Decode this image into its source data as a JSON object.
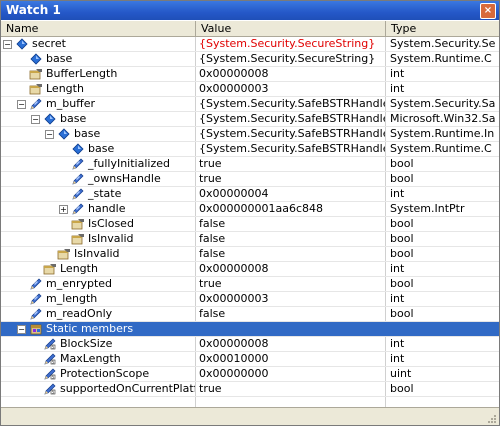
{
  "window": {
    "title": "Watch 1",
    "close_glyph": "×"
  },
  "columns": {
    "name": "Name",
    "value": "Value",
    "type": "Type"
  },
  "rows": [
    {
      "name": "secret",
      "value": "{System.Security.SecureString}",
      "type": "System.Security.Se",
      "indent": 0,
      "expander": "−",
      "icon": "field-icon",
      "value_red": true
    },
    {
      "name": "base",
      "value": "{System.Security.SecureString}",
      "type": "System.Runtime.C",
      "indent": 1,
      "expander": "",
      "icon": "field-icon",
      "value_red": false
    },
    {
      "name": "BufferLength",
      "value": "0x00000008",
      "type": "int",
      "indent": 1,
      "expander": "",
      "icon": "property-icon",
      "value_red": false
    },
    {
      "name": "Length",
      "value": "0x00000003",
      "type": "int",
      "indent": 1,
      "expander": "",
      "icon": "property-icon",
      "value_red": false
    },
    {
      "name": "m_buffer",
      "value": "{System.Security.SafeBSTRHandle}",
      "type": "System.Security.Sa",
      "indent": 1,
      "expander": "−",
      "icon": "pencil-icon",
      "value_red": false
    },
    {
      "name": "base",
      "value": "{System.Security.SafeBSTRHandle}",
      "type": "Microsoft.Win32.Sa",
      "indent": 2,
      "expander": "−",
      "icon": "field-icon",
      "value_red": false
    },
    {
      "name": "base",
      "value": "{System.Security.SafeBSTRHandle}",
      "type": "System.Runtime.In",
      "indent": 3,
      "expander": "−",
      "icon": "field-icon",
      "value_red": false
    },
    {
      "name": "base",
      "value": "{System.Security.SafeBSTRHandle}",
      "type": "System.Runtime.C",
      "indent": 4,
      "expander": "",
      "icon": "field-icon",
      "value_red": false
    },
    {
      "name": "_fullyInitialized",
      "value": "true",
      "type": "bool",
      "indent": 4,
      "expander": "",
      "icon": "pencil-icon",
      "value_red": false
    },
    {
      "name": "_ownsHandle",
      "value": "true",
      "type": "bool",
      "indent": 4,
      "expander": "",
      "icon": "pencil-icon",
      "value_red": false
    },
    {
      "name": "_state",
      "value": "0x00000004",
      "type": "int",
      "indent": 4,
      "expander": "",
      "icon": "pencil-icon",
      "value_red": false
    },
    {
      "name": "handle",
      "value": "0x000000001aa6c848",
      "type": "System.IntPtr",
      "indent": 4,
      "expander": "+",
      "icon": "pencil-icon",
      "value_red": false
    },
    {
      "name": "IsClosed",
      "value": "false",
      "type": "bool",
      "indent": 4,
      "expander": "",
      "icon": "property-icon",
      "value_red": false
    },
    {
      "name": "IsInvalid",
      "value": "false",
      "type": "bool",
      "indent": 4,
      "expander": "",
      "icon": "property-icon",
      "value_red": false
    },
    {
      "name": "IsInvalid",
      "value": "false",
      "type": "bool",
      "indent": 3,
      "expander": "",
      "icon": "property-icon",
      "value_red": false
    },
    {
      "name": "Length",
      "value": "0x00000008",
      "type": "int",
      "indent": 2,
      "expander": "",
      "icon": "property-icon",
      "value_red": false
    },
    {
      "name": "m_enrypted",
      "value": "true",
      "type": "bool",
      "indent": 1,
      "expander": "",
      "icon": "pencil-icon",
      "value_red": false
    },
    {
      "name": "m_length",
      "value": "0x00000003",
      "type": "int",
      "indent": 1,
      "expander": "",
      "icon": "pencil-icon",
      "value_red": false
    },
    {
      "name": "m_readOnly",
      "value": "false",
      "type": "bool",
      "indent": 1,
      "expander": "",
      "icon": "pencil-icon",
      "value_red": false
    },
    {
      "name": "Static members",
      "value": "",
      "type": "",
      "indent": 1,
      "expander": "−",
      "icon": "static-members-icon",
      "value_red": false,
      "selected": true
    },
    {
      "name": "BlockSize",
      "value": "0x00000008",
      "type": "int",
      "indent": 2,
      "expander": "",
      "icon": "static-field-icon",
      "value_red": false
    },
    {
      "name": "MaxLength",
      "value": "0x00010000",
      "type": "int",
      "indent": 2,
      "expander": "",
      "icon": "static-field-icon",
      "value_red": false
    },
    {
      "name": "ProtectionScope",
      "value": "0x00000000",
      "type": "uint",
      "indent": 2,
      "expander": "",
      "icon": "static-field-icon",
      "value_red": false
    },
    {
      "name": "supportedOnCurrentPlatfo",
      "value": "true",
      "type": "bool",
      "indent": 2,
      "expander": "",
      "icon": "static-field-icon",
      "value_red": false
    }
  ],
  "colors": {
    "selection": "#316ac5",
    "error_value": "#e00000",
    "title_bar": "#2558c8"
  }
}
